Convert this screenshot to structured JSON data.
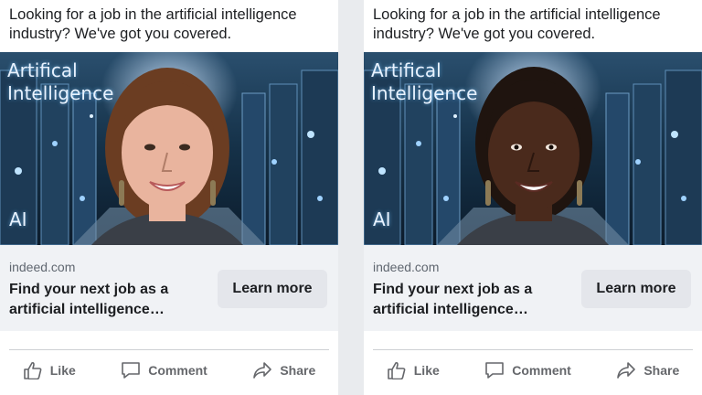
{
  "ads": [
    {
      "primary_text": "Looking for a job in the artificial intelligence industry? We've got you covered.",
      "image": {
        "title_line1": "Artifical",
        "title_line2": "Intelligence",
        "badge": "AI",
        "skin_color": "#e9b49e",
        "hair_color": "#6b3d22"
      },
      "link_domain": "indeed.com",
      "headline": "Find your next job as a artificial intelligence…",
      "cta_label": "Learn more",
      "actions": {
        "like": "Like",
        "comment": "Comment",
        "share": "Share"
      }
    },
    {
      "primary_text": "Looking for a job in the artificial intelligence industry? We've got you covered.",
      "image": {
        "title_line1": "Artifical",
        "title_line2": "Intelligence",
        "badge": "AI",
        "skin_color": "#4a2a1c",
        "hair_color": "#1f140f"
      },
      "link_domain": "indeed.com",
      "headline": "Find your next job as a artificial intelligence…",
      "cta_label": "Learn more",
      "actions": {
        "like": "Like",
        "comment": "Comment",
        "share": "Share"
      }
    }
  ],
  "icons": {
    "like": "thumbs-up-icon",
    "comment": "comment-bubble-icon",
    "share": "share-arrow-icon"
  },
  "colors": {
    "cta_background": "#e4e6eb",
    "footer_text": "#65676b",
    "link_bar": "#f0f2f5"
  }
}
